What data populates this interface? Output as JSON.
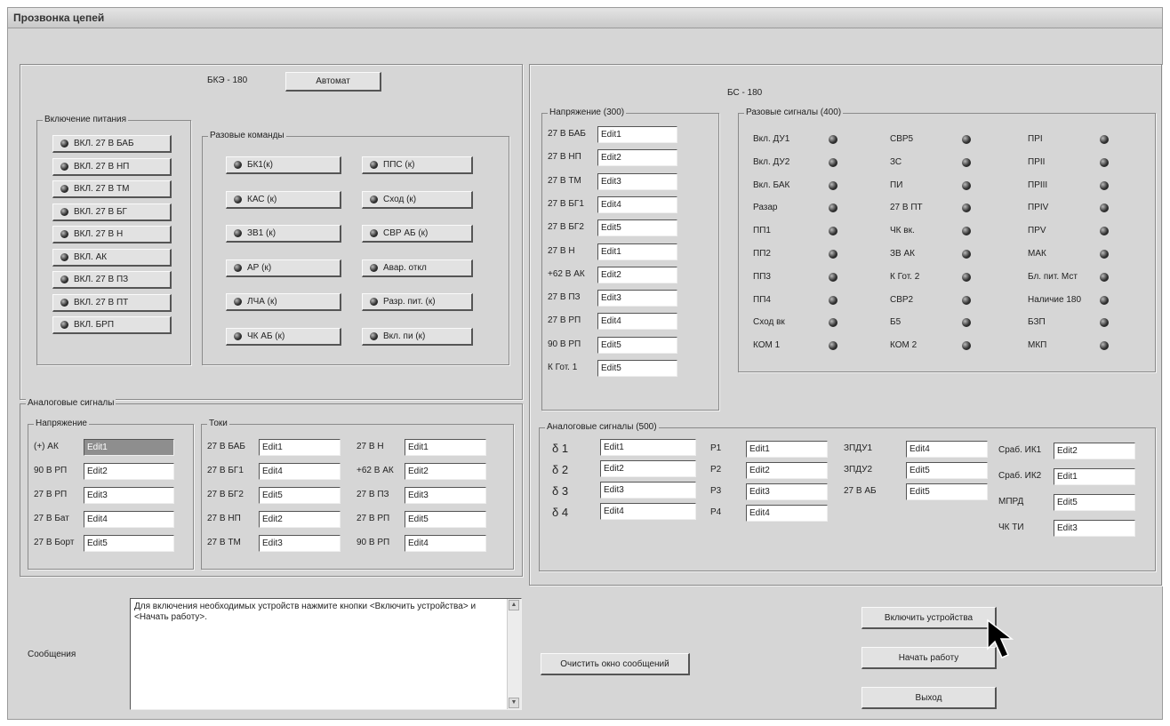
{
  "window": {
    "title": "Прозвонка цепей"
  },
  "bkz": {
    "title": "БКЭ - 180",
    "automat_button": "Автомат",
    "power": {
      "title": "Включение питания",
      "buttons": [
        "ВКЛ. 27 В БАБ",
        "ВКЛ. 27 В НП",
        "ВКЛ. 27 В ТМ",
        "ВКЛ. 27 В БГ",
        "ВКЛ. 27 В Н",
        "ВКЛ. АК",
        "ВКЛ. 27 В ПЗ",
        "ВКЛ. 27 В ПТ",
        "ВКЛ. БРП"
      ]
    },
    "commands": {
      "title": "Разовые команды",
      "left": [
        "БК1(к)",
        "КАС (к)",
        "ЗВ1 (к)",
        "АР (к)",
        "ЛЧА (к)",
        "ЧК АБ (к)"
      ],
      "right": [
        "ППС (к)",
        "Сход (к)",
        "СВР АБ (к)",
        "Авар. откл",
        "Разр. пит. (к)",
        "Вкл. пи (к)"
      ]
    },
    "analog": {
      "title": "Аналоговые сигналы",
      "voltage": {
        "title": "Напряжение",
        "rows": [
          {
            "label": "(+) АК",
            "value": "Edit1"
          },
          {
            "label": "90 В РП",
            "value": "Edit2"
          },
          {
            "label": "27 В РП",
            "value": "Edit3"
          },
          {
            "label": "27 В Бат",
            "value": "Edit4"
          },
          {
            "label": "27 В Борт",
            "value": "Edit5"
          }
        ]
      },
      "currents": {
        "title": "Токи",
        "col1": [
          {
            "label": "27 В БАБ",
            "value": "Edit1"
          },
          {
            "label": "27 В БГ1",
            "value": "Edit4"
          },
          {
            "label": "27 В БГ2",
            "value": "Edit5"
          },
          {
            "label": "27 В НП",
            "value": "Edit2"
          },
          {
            "label": "27 В ТМ",
            "value": "Edit3"
          }
        ],
        "col2": [
          {
            "label": "27 В Н",
            "value": "Edit1"
          },
          {
            "label": "+62 В АК",
            "value": "Edit2"
          },
          {
            "label": "27 В ПЗ",
            "value": "Edit3"
          },
          {
            "label": "27 В РП",
            "value": "Edit5"
          },
          {
            "label": "90 В РП",
            "value": "Edit4"
          }
        ]
      }
    }
  },
  "bs": {
    "title": "БС - 180",
    "voltage": {
      "title": "Напряжение (300)",
      "rows": [
        {
          "label": "27 В БАБ",
          "value": "Edit1"
        },
        {
          "label": "27 В НП",
          "value": "Edit2"
        },
        {
          "label": "27 В ТМ",
          "value": "Edit3"
        },
        {
          "label": "27 В БГ1",
          "value": "Edit4"
        },
        {
          "label": "27 В БГ2",
          "value": "Edit5"
        },
        {
          "label": "27 В Н",
          "value": "Edit1"
        },
        {
          "label": "+62 В АК",
          "value": "Edit2"
        },
        {
          "label": "27 В ПЗ",
          "value": "Edit3"
        },
        {
          "label": "27 В РП",
          "value": "Edit4"
        },
        {
          "label": "90 В РП",
          "value": "Edit5"
        },
        {
          "label": "К Гот. 1",
          "value": "Edit5"
        }
      ]
    },
    "signals": {
      "title": "Разовые сигналы (400)",
      "col1": [
        "Вкл. ДУ1",
        "Вкл. ДУ2",
        "Вкл. БАК",
        "Разар",
        "ПП1",
        "ПП2",
        "ПП3",
        "ПП4",
        "Сход вк",
        "КОМ 1"
      ],
      "col2": [
        "СВР5",
        "ЗС",
        "ПИ",
        "27 В ПТ",
        "ЧК вк.",
        "ЗВ АК",
        "К Гот. 2",
        "СВР2",
        "Б5",
        "КОМ 2"
      ],
      "col3": [
        "ПРI",
        "ПРII",
        "ПРIII",
        "ПРIV",
        "ПРV",
        "МАК",
        "Бл. пит. Мст",
        "Наличие 180",
        "БЗП",
        "МКП"
      ]
    },
    "analog": {
      "title": "Аналоговые сигналы (500)",
      "deltas": [
        {
          "label": "δ 1",
          "value": "Edit1"
        },
        {
          "label": "δ 2",
          "value": "Edit2"
        },
        {
          "label": "δ 3",
          "value": "Edit3"
        },
        {
          "label": "δ 4",
          "value": "Edit4"
        }
      ],
      "p": [
        {
          "label": "Р1",
          "value": "Edit1"
        },
        {
          "label": "Р2",
          "value": "Edit2"
        },
        {
          "label": "Р3",
          "value": "Edit3"
        },
        {
          "label": "Р4",
          "value": "Edit4"
        }
      ],
      "zp": [
        {
          "label": "ЗПДУ1",
          "value": "Edit4"
        },
        {
          "label": "ЗПДУ2",
          "value": "Edit5"
        },
        {
          "label": "27 В АБ",
          "value": "Edit5"
        }
      ],
      "right": [
        {
          "label": "Сраб. ИК1",
          "value": "Edit2"
        },
        {
          "label": "Сраб. ИК2",
          "value": "Edit1"
        },
        {
          "label": "МПРД",
          "value": "Edit5"
        },
        {
          "label": "ЧК ТИ",
          "value": "Edit3"
        }
      ]
    }
  },
  "messages": {
    "label": "Сообщения",
    "text": "Для включения необходимых устройств нажмите кнопки <Включить устройства> и <Начать работу>.",
    "clear_button": "Очистить окно сообщений"
  },
  "actions": {
    "enable_devices": "Включить устройства",
    "start_work": "Начать работу",
    "exit": "Выход"
  }
}
